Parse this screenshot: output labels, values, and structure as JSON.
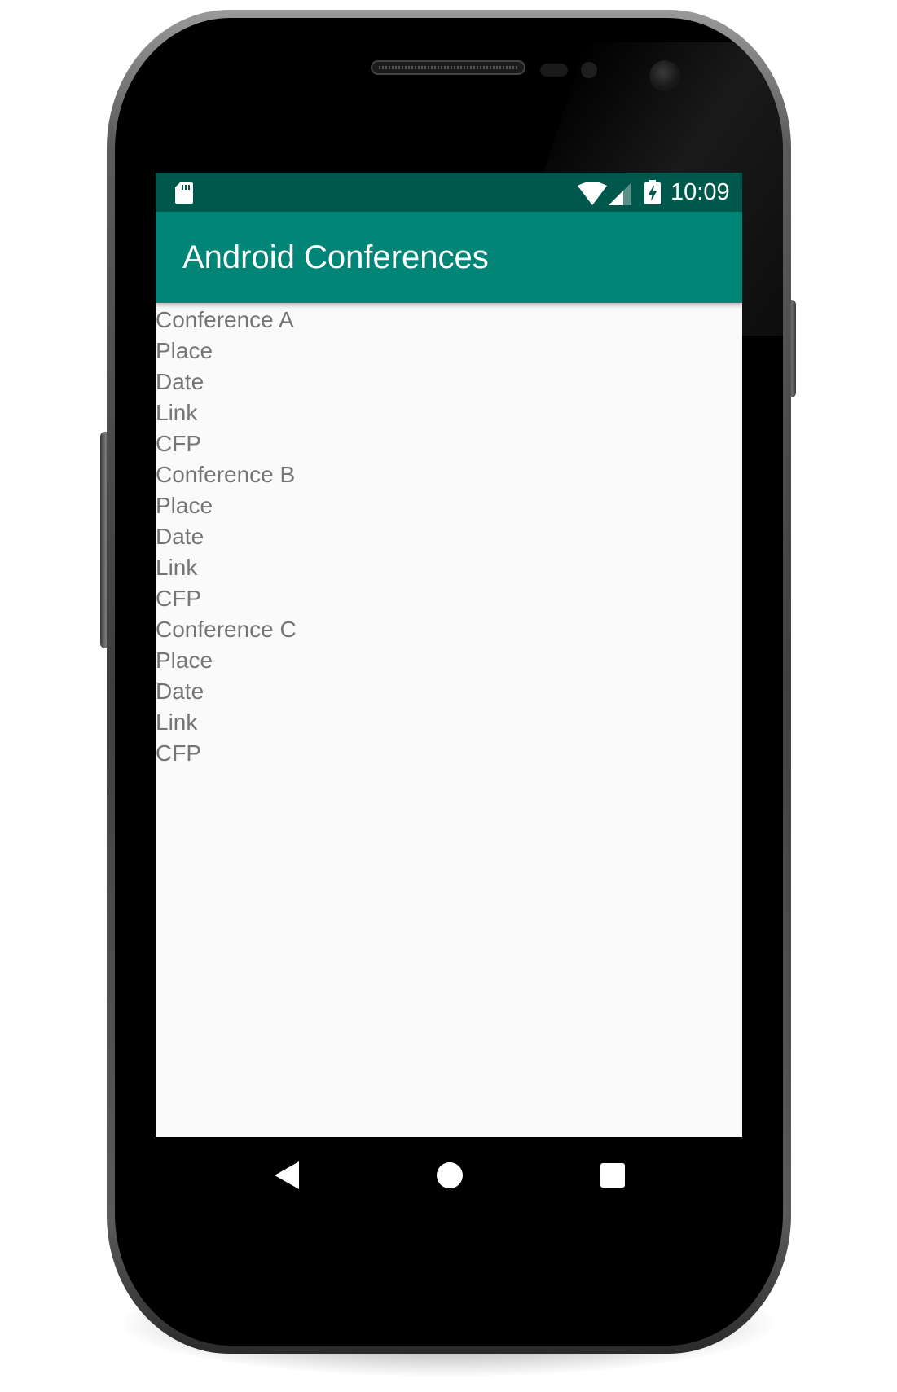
{
  "status_bar": {
    "time": "10:09",
    "icons": [
      "sd-card-icon",
      "wifi-icon",
      "cell-signal-icon",
      "battery-charging-icon"
    ]
  },
  "app_bar": {
    "title": "Android Conferences"
  },
  "conferences": [
    {
      "name": "Conference A",
      "place": "Place",
      "date": "Date",
      "link": "Link",
      "cfp": "CFP"
    },
    {
      "name": "Conference B",
      "place": "Place",
      "date": "Date",
      "link": "Link",
      "cfp": "CFP"
    },
    {
      "name": "Conference C",
      "place": "Place",
      "date": "Date",
      "link": "Link",
      "cfp": "CFP"
    }
  ],
  "nav_bar": {
    "icons": [
      "back-icon",
      "home-icon",
      "recents-icon"
    ]
  },
  "colors": {
    "status_bar": "#00574B",
    "app_bar": "#008577",
    "screen_background": "#FAFAFA",
    "list_text": "#757575"
  }
}
